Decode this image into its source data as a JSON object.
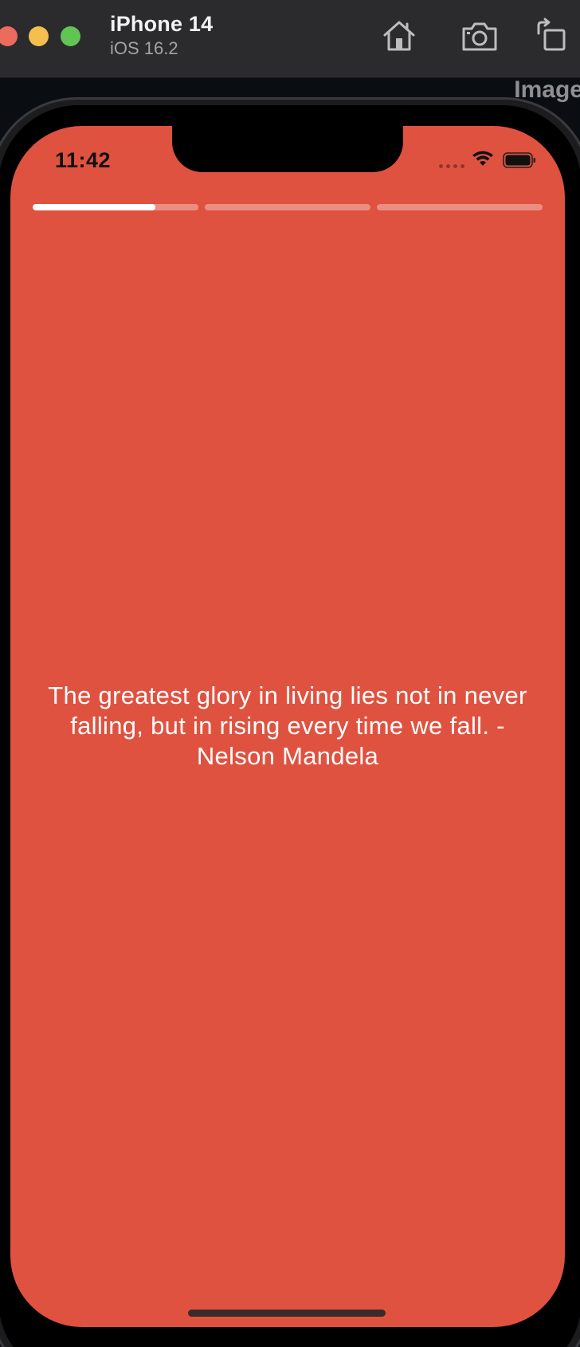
{
  "window": {
    "device_name": "iPhone 14",
    "os_version": "iOS 16.2",
    "traffic_colors": {
      "close": "#ed6a5e",
      "minimize": "#f5bf4f",
      "maximize": "#61c554"
    },
    "toolbar_icons": [
      "home-icon",
      "screenshot-icon",
      "rotate-icon"
    ],
    "side_caption": "Image"
  },
  "status_bar": {
    "time": "11:42",
    "icons": [
      "cellular-signal-icon",
      "wifi-icon",
      "battery-icon"
    ]
  },
  "story": {
    "progress": [
      {
        "segment": 1,
        "fill_fraction": 0.74
      },
      {
        "segment": 2,
        "fill_fraction": 0
      },
      {
        "segment": 3,
        "fill_fraction": 0
      }
    ],
    "background_color": "#e05240",
    "quote": "The greatest glory in living lies not in never falling, but in rising every time we fall. -Nelson Mandela"
  }
}
